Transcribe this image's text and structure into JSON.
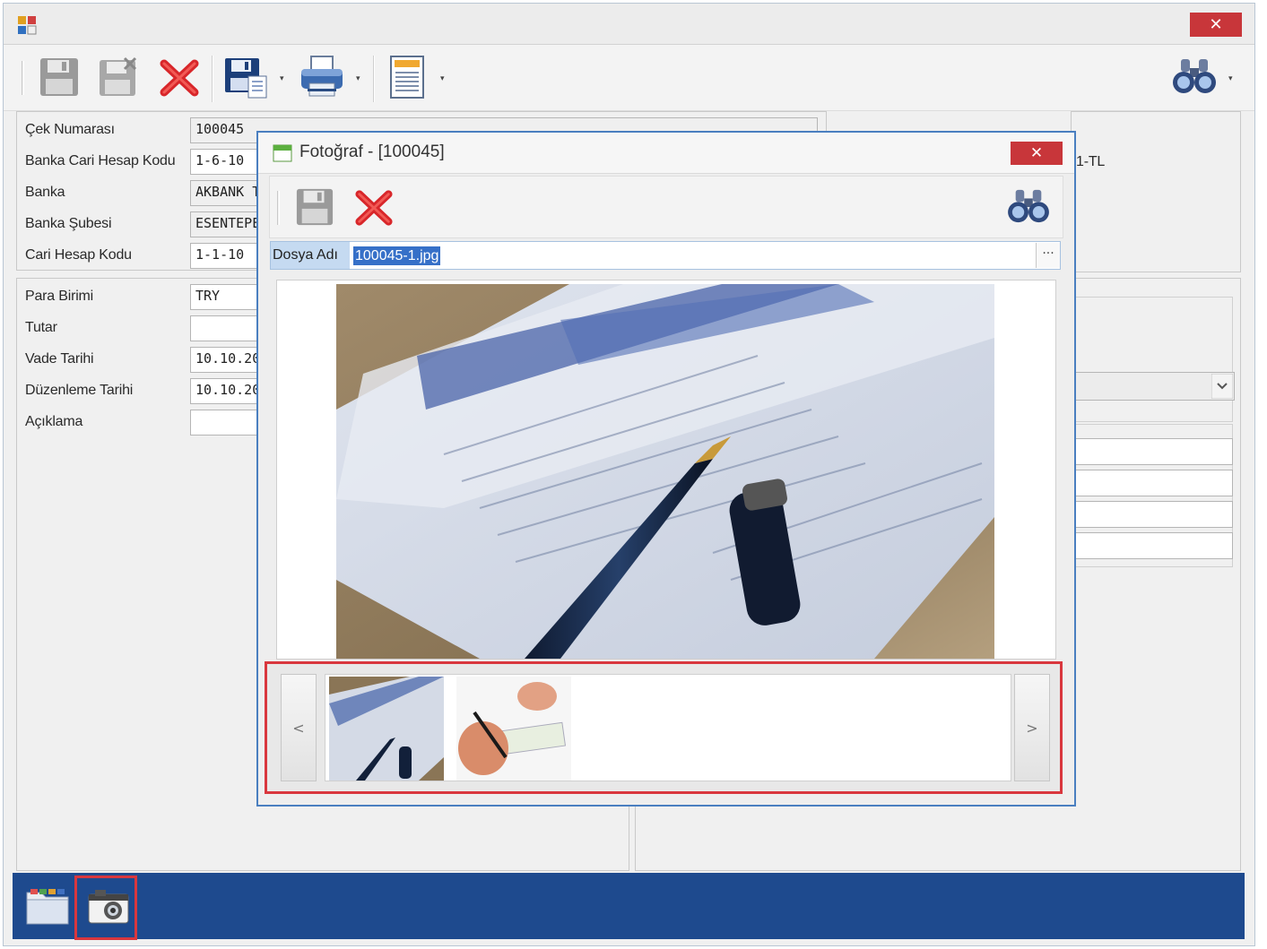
{
  "main_window": {
    "close_label": "✕"
  },
  "toolbar": {
    "buttons": [
      {
        "icon": "save-icon"
      },
      {
        "icon": "save-disabled-icon"
      },
      {
        "icon": "delete-icon"
      },
      {
        "icon": "save-as-icon"
      },
      {
        "icon": "print-icon"
      },
      {
        "icon": "report-icon"
      }
    ],
    "dropdown_arrow": "▾",
    "search_icon": "binoculars-icon"
  },
  "form": {
    "fields": [
      {
        "label": "Çek Numarası",
        "value": "100045"
      },
      {
        "label": "Banka Cari Hesap Kodu",
        "value": "1-6-10"
      },
      {
        "label": "Banka",
        "value": "AKBANK T"
      },
      {
        "label": "Banka Şubesi",
        "value": "ESENTEPE"
      },
      {
        "label": "Cari Hesap Kodu",
        "value": "1-1-10"
      }
    ],
    "fields2": [
      {
        "label": "Para Birimi",
        "value": "TRY"
      },
      {
        "label": "Tutar",
        "value": ""
      },
      {
        "label": "Vade Tarihi",
        "value": "10.10.20"
      },
      {
        "label": "Düzenleme Tarihi",
        "value": "10.10.20"
      },
      {
        "label": "Açıklama",
        "value": ""
      }
    ],
    "right_text": "1-TL"
  },
  "dialog": {
    "title": "Fotoğraf - [100045]",
    "close_label": "✕",
    "file_label": "Dosya Adı",
    "file_value": "100045-1.jpg",
    "browse_label": "···",
    "prev_label": "<",
    "next_label": ">"
  },
  "colors": {
    "bottom_bar": "#1e4a8e",
    "close": "#c8363a",
    "highlight": "#d9373e",
    "selection": "#3670c8"
  }
}
